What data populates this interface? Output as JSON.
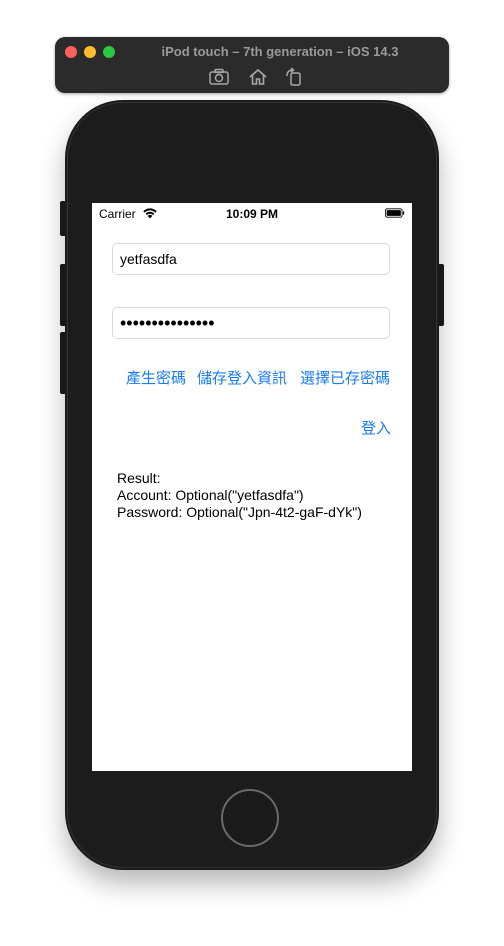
{
  "simulator": {
    "title": "iPod touch – 7th generation – iOS 14.3",
    "toolbar": {
      "screenshot_icon": "camera-icon",
      "home_icon": "home-icon",
      "rotate_icon": "rotate-icon"
    }
  },
  "status_bar": {
    "carrier": "Carrier",
    "time": "10:09 PM"
  },
  "form": {
    "account_value": "yetfasdfa",
    "password_masked": "•••••••••••••••"
  },
  "actions": {
    "generate_password": "產生密碼",
    "save_login": "儲存登入資訊",
    "choose_saved_password": "選擇已存密碼",
    "login": "登入"
  },
  "result": {
    "title": "Result:",
    "account_line": "Account: Optional(\"yetfasdfa\")",
    "password_line": "Password: Optional(\"Jpn-4t2-gaF-dYk\")"
  },
  "colors": {
    "link_blue": "#1a7cf2",
    "device_body": "#1b1b1b"
  }
}
